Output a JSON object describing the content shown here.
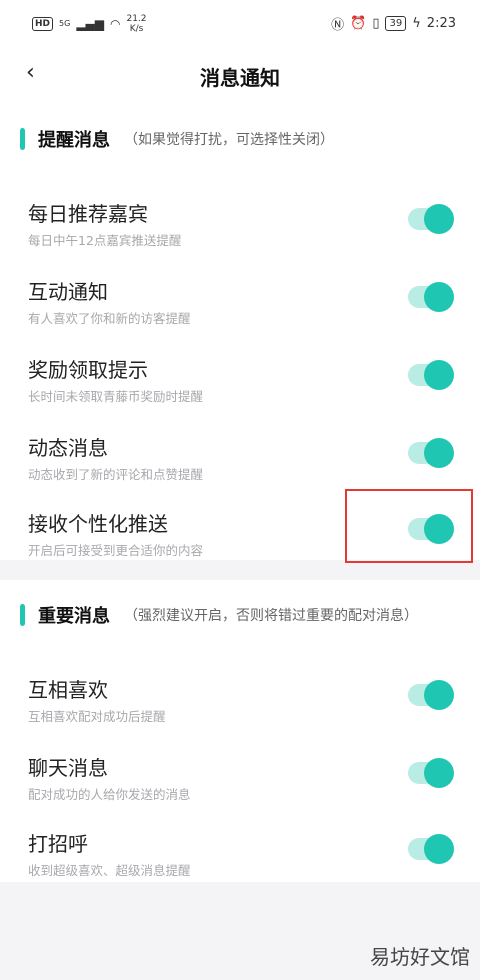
{
  "status_bar": {
    "hd": "HD",
    "signal": "5G",
    "speed_value": "21.2",
    "speed_unit": "K/s",
    "battery": "39",
    "time": "2:23"
  },
  "header": {
    "title": "消息通知"
  },
  "sections": [
    {
      "title": "提醒消息",
      "note": "（如果觉得打扰，可选择性关闭）",
      "items": [
        {
          "title": "每日推荐嘉宾",
          "subtitle": "每日中午12点嘉宾推送提醒",
          "enabled": true
        },
        {
          "title": "互动通知",
          "subtitle": "有人喜欢了你和新的访客提醒",
          "enabled": true
        },
        {
          "title": "奖励领取提示",
          "subtitle": "长时间未领取青藤币奖励时提醒",
          "enabled": true
        },
        {
          "title": "动态消息",
          "subtitle": "动态收到了新的评论和点赞提醒",
          "enabled": true
        },
        {
          "title": "接收个性化推送",
          "subtitle": "开启后可接受到更合适你的内容",
          "enabled": true
        }
      ]
    },
    {
      "title": "重要消息",
      "note": "（强烈建议开启，否则将错过重要的配对消息）",
      "items": [
        {
          "title": "互相喜欢",
          "subtitle": "互相喜欢配对成功后提醒",
          "enabled": true
        },
        {
          "title": "聊天消息",
          "subtitle": "配对成功的人给你发送的消息",
          "enabled": true
        },
        {
          "title": "打招呼",
          "subtitle": "收到超级喜欢、超级消息提醒",
          "enabled": true
        }
      ]
    }
  ],
  "watermark": "易坊好文馆",
  "colors": {
    "accent": "#1fc7b2",
    "toggle_track": "#b9ece4",
    "highlight": "#e53935"
  }
}
